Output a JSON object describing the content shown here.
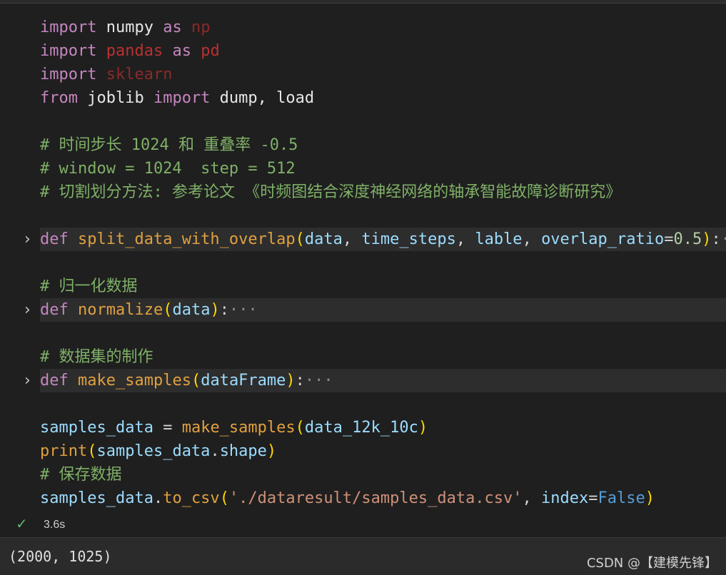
{
  "code": {
    "l1": {
      "kw": "import",
      "mod": " numpy ",
      "as": "as",
      "alias": " np"
    },
    "l2": {
      "kw": "import",
      "mod": " pandas ",
      "as": "as",
      "alias": " pd"
    },
    "l3": {
      "kw": "import",
      "mod": " sklearn"
    },
    "l4": {
      "from": "from",
      "mod": " joblib ",
      "imp": "import",
      "names": " dump, load"
    },
    "l5": "# 时间步长 1024 和 重叠率 -0.5",
    "l6": "# window = 1024  step = 512",
    "l7": "# 切割划分方法: 参考论文 《时频图结合深度神经网络的轴承智能故障诊断研究》",
    "l8": {
      "def": "def",
      "fn": "split_data_with_overlap",
      "p1": "data",
      "p2": "time_steps",
      "p3": "lable",
      "p4": "overlap_ratio",
      "eq": "=",
      "val": "0.5",
      "colon": ":",
      "ellip": "···"
    },
    "l9": "# 归一化数据",
    "l10": {
      "def": "def",
      "fn": "normalize",
      "p1": "data",
      "colon": ":",
      "ellip": "···"
    },
    "l11": "# 数据集的制作",
    "l12": {
      "def": "def",
      "fn": "make_samples",
      "p1": "dataFrame",
      "colon": ":",
      "ellip": "···"
    },
    "l13": {
      "var": "samples_data",
      "eq": " = ",
      "fn": "make_samples",
      "arg": "data_12k_10c"
    },
    "l14": {
      "fn": "print",
      "var": "samples_data",
      "dot": ".",
      "attr": "shape"
    },
    "l15": "# 保存数据",
    "l16": {
      "var": "samples_data",
      "dot": ".",
      "fn": "to_csv",
      "str": "'./dataresult/samples_data.csv'",
      "comma": ", ",
      "kw": "index",
      "eq": "=",
      "val": "False"
    }
  },
  "status": {
    "check": "✓",
    "time": "3.6s"
  },
  "output": "(2000, 1025)",
  "watermark": "CSDN @【建模先锋】",
  "colors": {
    "background": "#1f1f1f",
    "keyword": "#c586c0",
    "function": "#e0a040",
    "param": "#9cdcfe",
    "comment": "#7fb067",
    "string": "#ce9178",
    "check": "#5fb56f"
  }
}
